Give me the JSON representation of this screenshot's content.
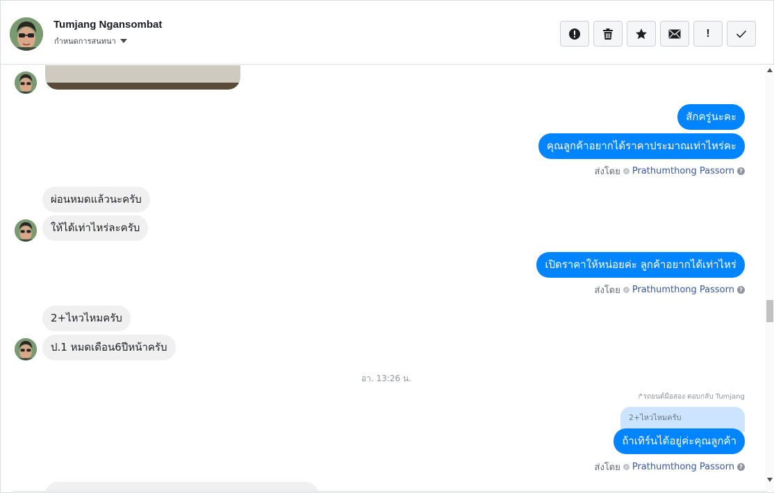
{
  "header": {
    "contact_name": "Tumjang Ngansombat",
    "assign_label": "กำหนดการสนทนา",
    "toolbar": [
      {
        "icon": "alert-icon"
      },
      {
        "icon": "trash-icon"
      },
      {
        "icon": "star-icon"
      },
      {
        "icon": "envelope-icon"
      },
      {
        "icon": "exclamation-icon",
        "label": "!"
      },
      {
        "icon": "check-icon"
      }
    ]
  },
  "messages": {
    "out1": "สักครู่นะคะ",
    "out2": "คุณลูกค้าอยากได้ราคาประมาณเท่าไหร่คะ",
    "in1": "ผ่อนหมดแล้วนะครับ",
    "in2": "ให้ได้เท่าไหร่ละครับ",
    "out3": "เปิดราคาให้หน่อยค่ะ ลูกค้าอยากได้เท่าไหร่",
    "in3": "2+ไหวไหมครับ",
    "in4": "ป.1 หมดเดือน6ปีหน้าครับ",
    "timestamp": "อา. 13:26 น.",
    "reply_note": "↱รถยนต์มือสอง ตอบกลับ Tumjang",
    "quote": "2+ไหวไหมครับ",
    "out4": "ถ้าเทิร์นได้อยู่ค่ะคุณลูกค้า"
  },
  "sent_by": {
    "prefix": "ส่งโดย",
    "agent": "Prathumthong Passorn",
    "help": "?"
  },
  "colors": {
    "outgoing": "#0084ff",
    "incoming": "#f0f0f0",
    "quote_bg": "#cce4ff",
    "agent_link": "#385898"
  }
}
